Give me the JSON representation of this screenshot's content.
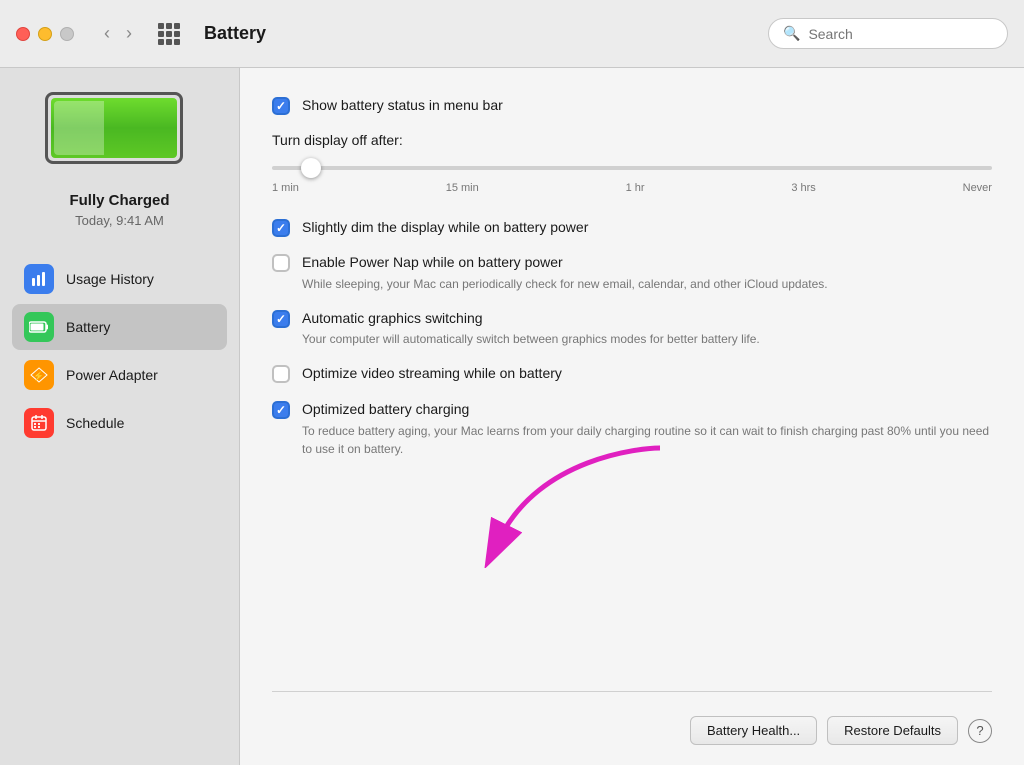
{
  "titlebar": {
    "title": "Battery",
    "search_placeholder": "Search",
    "back_label": "‹",
    "forward_label": "›"
  },
  "sidebar": {
    "battery_status": "Fully Charged",
    "battery_time": "Today, 9:41 AM",
    "nav_items": [
      {
        "id": "usage-history",
        "label": "Usage History",
        "icon_type": "blue"
      },
      {
        "id": "battery",
        "label": "Battery",
        "icon_type": "green",
        "active": true
      },
      {
        "id": "power-adapter",
        "label": "Power Adapter",
        "icon_type": "orange"
      },
      {
        "id": "schedule",
        "label": "Schedule",
        "icon_type": "red"
      }
    ]
  },
  "content": {
    "show_battery_status_label": "Show battery status in menu bar",
    "show_battery_status_checked": true,
    "turn_display_off_label": "Turn display off after:",
    "slider_labels": [
      "1 min",
      "15 min",
      "1 hr",
      "3 hrs",
      "Never"
    ],
    "slightly_dim_label": "Slightly dim the display while on battery power",
    "slightly_dim_checked": true,
    "power_nap_label": "Enable Power Nap while on battery power",
    "power_nap_checked": false,
    "power_nap_description": "While sleeping, your Mac can periodically check for new email, calendar, and other iCloud updates.",
    "auto_graphics_label": "Automatic graphics switching",
    "auto_graphics_checked": true,
    "auto_graphics_description": "Your computer will automatically switch between graphics modes for better battery life.",
    "optimize_video_label": "Optimize video streaming while on battery",
    "optimize_video_checked": false,
    "optimized_charging_label": "Optimized battery charging",
    "optimized_charging_checked": true,
    "optimized_charging_description": "To reduce battery aging, your Mac learns from your daily charging routine so it can wait to finish charging past 80% until you need to use it on battery.",
    "battery_health_btn": "Battery Health...",
    "restore_defaults_btn": "Restore Defaults",
    "help_btn": "?"
  }
}
